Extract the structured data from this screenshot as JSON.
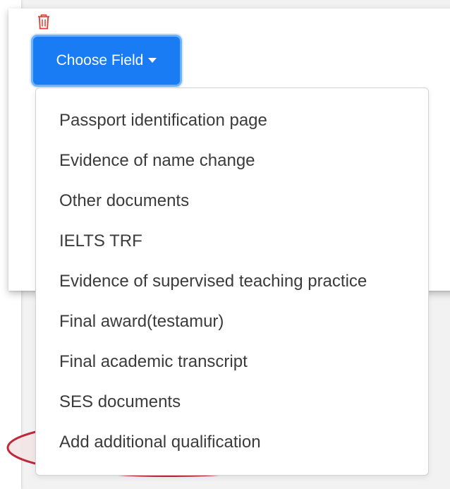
{
  "dropdown": {
    "button_label": "Choose Field",
    "items": [
      {
        "label": "Passport identification page"
      },
      {
        "label": "Evidence of name change"
      },
      {
        "label": "Other documents"
      },
      {
        "label": "IELTS TRF"
      },
      {
        "label": "Evidence of supervised teaching practice"
      },
      {
        "label": "Final award(testamur)"
      },
      {
        "label": "Final academic transcript"
      },
      {
        "label": "SES documents"
      },
      {
        "label": "Add additional qualification"
      }
    ]
  },
  "colors": {
    "button_bg": "#1a7cf5",
    "delete_icon": "#e53935",
    "annotation_outline": "#c0283a",
    "annotation_fill": "#f3e4e6"
  },
  "icons": {
    "delete": "trash-icon",
    "caret": "caret-down-icon"
  }
}
